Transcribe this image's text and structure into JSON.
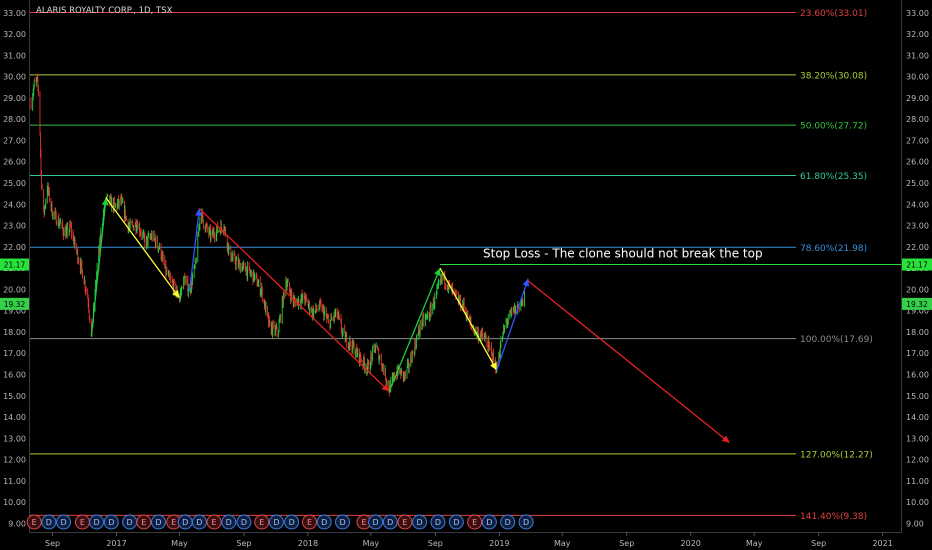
{
  "chart_data": {
    "type": "candlestick",
    "title": "ALARIS ROYALTY CORP., 1D, TSX",
    "ylim": [
      8.6,
      33.6
    ],
    "y_ticks": [
      9,
      10,
      11,
      12,
      13,
      14,
      15,
      16,
      17,
      18,
      19,
      20,
      21,
      22,
      23,
      24,
      25,
      26,
      27,
      28,
      29,
      30,
      31,
      32,
      33
    ],
    "y_tick_labels": [
      "9.00",
      "10.00",
      "11.00",
      "12.00",
      "13.00",
      "14.00",
      "15.00",
      "16.00",
      "17.00",
      "18.00",
      "19.00",
      "20.00",
      "21.00",
      "22.00",
      "23.00",
      "24.00",
      "25.00",
      "26.00",
      "27.00",
      "28.00",
      "29.00",
      "30.00",
      "31.00",
      "32.00",
      "33.00"
    ],
    "x_range": [
      "2016-07-20",
      "2021-02-05"
    ],
    "x_ticks": [
      {
        "date": "2016-09-01",
        "label": "Sep"
      },
      {
        "date": "2017-01-01",
        "label": "2017"
      },
      {
        "date": "2017-05-01",
        "label": "May"
      },
      {
        "date": "2017-09-01",
        "label": "Sep"
      },
      {
        "date": "2018-01-01",
        "label": "2018"
      },
      {
        "date": "2018-05-01",
        "label": "May"
      },
      {
        "date": "2018-09-01",
        "label": "Sep"
      },
      {
        "date": "2019-01-01",
        "label": "2019"
      },
      {
        "date": "2019-05-01",
        "label": "May"
      },
      {
        "date": "2019-09-01",
        "label": "Sep"
      },
      {
        "date": "2020-01-01",
        "label": "2020"
      },
      {
        "date": "2020-05-01",
        "label": "May"
      },
      {
        "date": "2020-09-01",
        "label": "Sep"
      },
      {
        "date": "2021-01-01",
        "label": "2021"
      }
    ],
    "price_path": [
      [
        "2016-07-22",
        28.8
      ],
      [
        "2016-07-28",
        29.6
      ],
      [
        "2016-08-02",
        29.8
      ],
      [
        "2016-08-06",
        29.2
      ],
      [
        "2016-08-08",
        27.4
      ],
      [
        "2016-08-10",
        25.5
      ],
      [
        "2016-08-15",
        23.5
      ],
      [
        "2016-08-22",
        24.8
      ],
      [
        "2016-09-01",
        23.6
      ],
      [
        "2016-09-15",
        23.1
      ],
      [
        "2016-09-25",
        22.6
      ],
      [
        "2016-10-05",
        22.9
      ],
      [
        "2016-10-20",
        21.5
      ],
      [
        "2016-10-30",
        20.6
      ],
      [
        "2016-11-08",
        19.5
      ],
      [
        "2016-11-14",
        17.8
      ],
      [
        "2016-11-25",
        21.0
      ],
      [
        "2016-12-05",
        23.2
      ],
      [
        "2016-12-12",
        24.3
      ],
      [
        "2016-12-28",
        23.9
      ],
      [
        "2017-01-10",
        24.1
      ],
      [
        "2017-01-25",
        22.9
      ],
      [
        "2017-02-10",
        23.1
      ],
      [
        "2017-02-25",
        22.2
      ],
      [
        "2017-03-10",
        22.5
      ],
      [
        "2017-03-25",
        21.9
      ],
      [
        "2017-04-05",
        20.8
      ],
      [
        "2017-04-18",
        20.2
      ],
      [
        "2017-05-01",
        19.6
      ],
      [
        "2017-05-10",
        20.5
      ],
      [
        "2017-05-20",
        19.9
      ],
      [
        "2017-06-01",
        21.2
      ],
      [
        "2017-06-10",
        23.7
      ],
      [
        "2017-06-18",
        23.0
      ],
      [
        "2017-06-30",
        22.5
      ],
      [
        "2017-07-12",
        22.8
      ],
      [
        "2017-07-25",
        23.0
      ],
      [
        "2017-08-05",
        21.6
      ],
      [
        "2017-08-20",
        21.2
      ],
      [
        "2017-09-05",
        20.9
      ],
      [
        "2017-09-20",
        20.6
      ],
      [
        "2017-10-05",
        19.9
      ],
      [
        "2017-10-20",
        18.2
      ],
      [
        "2017-11-05",
        18.0
      ],
      [
        "2017-11-20",
        20.4
      ],
      [
        "2017-12-05",
        19.4
      ],
      [
        "2017-12-25",
        19.6
      ],
      [
        "2018-01-10",
        18.9
      ],
      [
        "2018-01-25",
        19.2
      ],
      [
        "2018-02-10",
        18.4
      ],
      [
        "2018-02-25",
        18.9
      ],
      [
        "2018-03-10",
        17.8
      ],
      [
        "2018-03-25",
        17.4
      ],
      [
        "2018-04-10",
        16.8
      ],
      [
        "2018-04-25",
        16.3
      ],
      [
        "2018-05-10",
        17.3
      ],
      [
        "2018-05-25",
        16.3
      ],
      [
        "2018-06-05",
        15.3
      ],
      [
        "2018-06-20",
        16.2
      ],
      [
        "2018-07-05",
        15.9
      ],
      [
        "2018-07-20",
        17.0
      ],
      [
        "2018-08-05",
        18.4
      ],
      [
        "2018-08-20",
        18.8
      ],
      [
        "2018-09-05",
        19.9
      ],
      [
        "2018-09-15",
        20.6
      ],
      [
        "2018-09-28",
        20.1
      ],
      [
        "2018-10-10",
        19.6
      ],
      [
        "2018-10-25",
        19.2
      ],
      [
        "2018-11-10",
        18.2
      ],
      [
        "2018-11-22",
        17.9
      ],
      [
        "2018-12-05",
        17.7
      ],
      [
        "2018-12-18",
        16.9
      ],
      [
        "2018-12-27",
        16.3
      ],
      [
        "2019-01-05",
        17.6
      ],
      [
        "2019-01-15",
        18.5
      ],
      [
        "2019-01-28",
        19.0
      ],
      [
        "2019-02-10",
        19.3
      ],
      [
        "2019-02-19",
        19.5
      ]
    ],
    "trend_arrows": [
      {
        "from": [
          "2016-11-14",
          17.8
        ],
        "to": [
          "2016-12-12",
          24.3
        ],
        "color": "#1fcc3c"
      },
      {
        "from": [
          "2016-12-12",
          24.3
        ],
        "to": [
          "2017-05-01",
          19.6
        ],
        "color": "#ffff33"
      },
      {
        "from": [
          "2017-05-20",
          19.9
        ],
        "to": [
          "2017-06-08",
          23.8
        ],
        "color": "#3355ff"
      },
      {
        "from": [
          "2017-06-08",
          23.8
        ],
        "to": [
          "2018-06-05",
          15.2
        ],
        "color": "#e82020"
      },
      {
        "from": [
          "2018-06-05",
          15.2
        ],
        "to": [
          "2018-09-10",
          21.0
        ],
        "color": "#1fcc3c"
      },
      {
        "from": [
          "2018-09-10",
          21.0
        ],
        "to": [
          "2018-12-27",
          16.2
        ],
        "color": "#ffff33"
      },
      {
        "from": [
          "2018-12-27",
          16.2
        ],
        "to": [
          "2019-02-25",
          20.5
        ],
        "color": "#3355ff"
      },
      {
        "from": [
          "2019-02-25",
          20.4
        ],
        "to": [
          "2020-03-15",
          12.8
        ],
        "color": "#e82020"
      }
    ],
    "fib_levels": [
      {
        "label": "23.60%(33.01)",
        "price": 33.01,
        "color": "#e04040"
      },
      {
        "label": "38.20%(30.08)",
        "price": 30.08,
        "color": "#a8cf3a"
      },
      {
        "label": "50.00%(27.72)",
        "price": 27.72,
        "color": "#2ec23e"
      },
      {
        "label": "61.80%(25.35)",
        "price": 25.35,
        "color": "#36c896"
      },
      {
        "label": "78.60%(21.98)",
        "price": 21.98,
        "color": "#3a8fd8"
      },
      {
        "label": "100.00%(17.69)",
        "price": 17.69,
        "color": "#8c8c8c"
      },
      {
        "label": "127.00%(12.27)",
        "price": 12.27,
        "color": "#a8cf3a"
      },
      {
        "label": "141.40%(9.38)",
        "price": 9.38,
        "color": "#e04040"
      }
    ],
    "stop_loss": {
      "price": 21.17,
      "label": "21.17",
      "from": "2018-09-10",
      "text": "Stop Loss  - The clone should not break the top"
    },
    "last_price": {
      "price": 19.32,
      "label": "19.32"
    },
    "events": [
      {
        "date": "2016-07-28",
        "type": "E"
      },
      {
        "date": "2016-08-25",
        "type": "D"
      },
      {
        "date": "2016-09-22",
        "type": "D"
      },
      {
        "date": "2016-10-28",
        "type": "E"
      },
      {
        "date": "2016-11-24",
        "type": "D"
      },
      {
        "date": "2016-12-22",
        "type": "D"
      },
      {
        "date": "2017-01-26",
        "type": "D"
      },
      {
        "date": "2017-02-22",
        "type": "E"
      },
      {
        "date": "2017-03-22",
        "type": "D"
      },
      {
        "date": "2017-04-20",
        "type": "E"
      },
      {
        "date": "2017-05-12",
        "type": "D"
      },
      {
        "date": "2017-06-08",
        "type": "D"
      },
      {
        "date": "2017-07-06",
        "type": "E"
      },
      {
        "date": "2017-08-03",
        "type": "D"
      },
      {
        "date": "2017-09-01",
        "type": "D"
      },
      {
        "date": "2017-10-05",
        "type": "E"
      },
      {
        "date": "2017-11-02",
        "type": "D"
      },
      {
        "date": "2017-12-01",
        "type": "D"
      },
      {
        "date": "2018-01-04",
        "type": "E"
      },
      {
        "date": "2018-02-01",
        "type": "D"
      },
      {
        "date": "2018-03-08",
        "type": "D"
      },
      {
        "date": "2018-04-18",
        "type": "E"
      },
      {
        "date": "2018-05-10",
        "type": "D"
      },
      {
        "date": "2018-06-07",
        "type": "D"
      },
      {
        "date": "2018-07-05",
        "type": "E"
      },
      {
        "date": "2018-08-02",
        "type": "D"
      },
      {
        "date": "2018-09-06",
        "type": "D"
      },
      {
        "date": "2018-10-11",
        "type": "D"
      },
      {
        "date": "2018-11-15",
        "type": "E"
      },
      {
        "date": "2018-12-13",
        "type": "D"
      },
      {
        "date": "2019-01-17",
        "type": "D"
      },
      {
        "date": "2019-02-21",
        "type": "D"
      }
    ],
    "colors": {
      "up": "#26c940",
      "down": "#e8332e",
      "background": "#000000",
      "grid": "#1c1c1c",
      "axis_text": "#b8b8b8"
    }
  }
}
